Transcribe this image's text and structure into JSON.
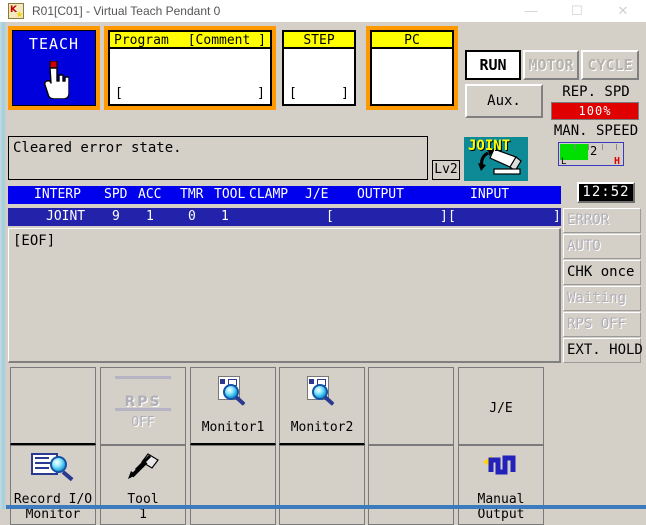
{
  "window": {
    "title": "R01[C01] - Virtual Teach Pendant 0",
    "minimize_label": "—",
    "maximize_label": "☐",
    "close_label": "✕",
    "icon_name": "app-icon"
  },
  "mode_button": {
    "label": "TEACH",
    "icon": "hand-pointer-icon",
    "active_color": "#0000dd",
    "highlight_color": "#ff9900"
  },
  "program_field": {
    "header_left": "Program",
    "header_right": "[Comment ]",
    "value": "",
    "bracket_open": "[",
    "bracket_close": "]",
    "highlighted": true
  },
  "step_field": {
    "header": "STEP",
    "value": "",
    "bracket_open": "[",
    "bracket_close": "]",
    "highlighted": false
  },
  "pc_field": {
    "header": "PC",
    "value": "",
    "highlighted": true
  },
  "lamps": {
    "run": "RUN",
    "motor": "MOTOR",
    "cycle": "CYCLE",
    "run_active": true,
    "motor_active": false,
    "cycle_active": false
  },
  "aux_button": {
    "label": "Aux."
  },
  "rep_speed": {
    "label": "REP. SPD",
    "value": "100%",
    "bar_color": "#e00000"
  },
  "man_speed": {
    "label": "MAN. SPEED",
    "value": "2",
    "low_mark": "L",
    "high_mark": "H",
    "fill_color": "#00e000",
    "fill_percent": 42
  },
  "message_bar": {
    "text": "Cleared error state."
  },
  "level_badge": {
    "label": "Lv2"
  },
  "joint_button": {
    "label": "JOINT",
    "icon": "robot-arm-icon",
    "bg": "#0d8a95"
  },
  "clock": {
    "time": "12:52"
  },
  "program_table": {
    "columns": [
      "INTERP",
      "SPD",
      "ACC",
      "TMR",
      "TOOL",
      "CLAMP",
      "J/E",
      "OUTPUT",
      "INPUT"
    ],
    "row": {
      "interp": "JOINT",
      "spd": "9",
      "acc": "1",
      "tmr": "0",
      "tool": "1",
      "clamp": "",
      "je": "",
      "output_open": "[",
      "output_close": "]",
      "input_open": "[",
      "input_close": "]"
    },
    "body_text": "[EOF]"
  },
  "status_stack": [
    {
      "label": "ERROR",
      "active": false
    },
    {
      "label": "AUTO",
      "active": false
    },
    {
      "label": "CHK once",
      "active": true
    },
    {
      "label": "Waiting",
      "active": false
    },
    {
      "label": "RPS OFF",
      "active": false
    },
    {
      "label": "EXT. HOLD",
      "active": true
    }
  ],
  "function_keys": {
    "top_row": [
      {
        "label": "",
        "icon": "",
        "enabled": true
      },
      {
        "label": "OFF",
        "icon": "rps-icon",
        "enabled": false,
        "sub": "RPS"
      },
      {
        "label": "Monitor1",
        "icon": "monitor-icon",
        "enabled": true
      },
      {
        "label": "Monitor2",
        "icon": "monitor-icon",
        "enabled": true
      },
      {
        "label": "",
        "icon": "",
        "enabled": true
      },
      {
        "label": "J/E",
        "icon": "",
        "enabled": true
      }
    ],
    "bottom_row": [
      {
        "label_1": "Record I/O",
        "label_2": "Monitor",
        "icon": "record-io-monitor-icon",
        "enabled": true
      },
      {
        "label_1": "Tool",
        "label_2": "1",
        "icon": "tool-icon",
        "enabled": true
      },
      {
        "label_1": "",
        "label_2": "",
        "icon": "",
        "enabled": true
      },
      {
        "label_1": "",
        "label_2": "",
        "icon": "",
        "enabled": true
      },
      {
        "label_1": "",
        "label_2": "",
        "icon": "",
        "enabled": true
      },
      {
        "label_1": "Manual",
        "label_2": "Output",
        "icon": "manual-output-icon",
        "enabled": true
      }
    ]
  }
}
